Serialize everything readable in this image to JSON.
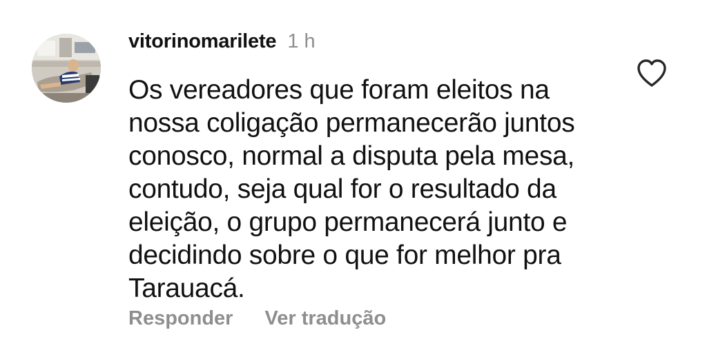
{
  "comment": {
    "username": "vitorinomarilete",
    "time": "1 h",
    "text_lines": [
      "Os vereadores que foram eleitos na",
      "nossa coligação permanecerão juntos",
      "conosco, normal a disputa pela mesa,",
      "contudo, seja qual for o resultado da",
      "eleição, o grupo permanecerá junto e",
      "decidindo sobre o que for melhor pra",
      "Tarauacá."
    ],
    "actions": {
      "reply": "Responder",
      "translate": "Ver tradução"
    },
    "like_icon": "heart-outline-icon"
  }
}
